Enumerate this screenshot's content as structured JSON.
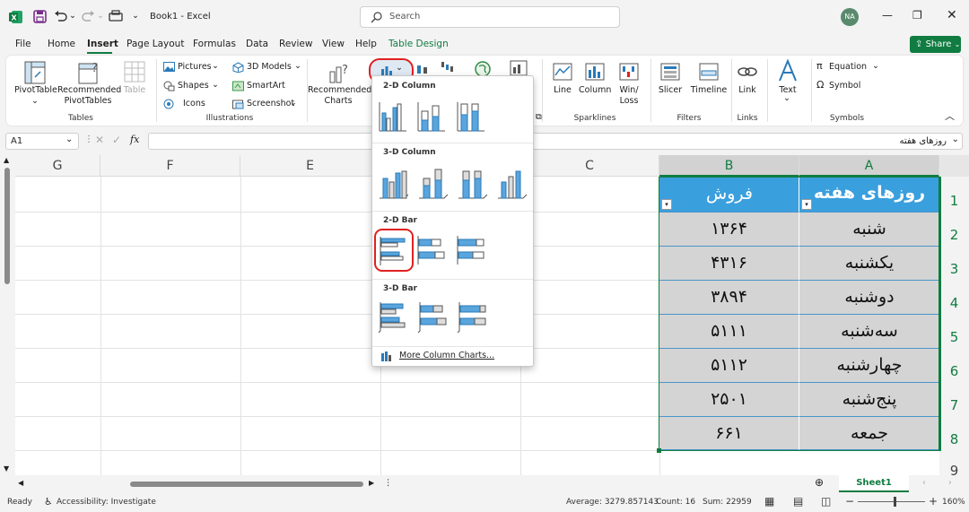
{
  "titlebar": {
    "title": "Book1 - Excel",
    "search_placeholder": "Search",
    "user_initials": "NA"
  },
  "tabs": [
    "File",
    "Home",
    "Insert",
    "Page Layout",
    "Formulas",
    "Data",
    "Review",
    "View",
    "Help",
    "Table Design"
  ],
  "share": "Share",
  "ribbon": {
    "pivottable": "PivotTable",
    "rec_pivot": "Recommended PivotTables",
    "table": "Table",
    "tables_group": "Tables",
    "pictures": "Pictures",
    "shapes": "Shapes",
    "icons": "Icons",
    "models": "3D Models",
    "smartart": "SmartArt",
    "screenshot": "Screenshot",
    "illustrations_group": "Illustrations",
    "rec_charts": "Recommended Charts",
    "line": "Line",
    "column": "Column",
    "winloss": "Win/ Loss",
    "sparklines_group": "Sparklines",
    "slicer": "Slicer",
    "timeline": "Timeline",
    "filters_group": "Filters",
    "link": "Link",
    "links_group": "Links",
    "text": "Text",
    "equation": "Equation",
    "symbol": "Symbol",
    "symbols_group": "Symbols"
  },
  "formula_bar": {
    "name_box": "A1",
    "content": "روزهای هفته",
    "fx": "fx"
  },
  "columns": [
    "G",
    "F",
    "E",
    "C",
    "B",
    "A"
  ],
  "rows": [
    "1",
    "2",
    "3",
    "4",
    "5",
    "6",
    "7",
    "8",
    "9"
  ],
  "table": {
    "header_a": "روزهای هفته",
    "header_b": "فروش",
    "days": [
      "شنبه",
      "یکشنبه",
      "دوشنبه",
      "سه‌شنبه",
      "چهارشنبه",
      "پنج‌شنبه",
      "جمعه"
    ],
    "sales": [
      "۱۳۶۴",
      "۴۳۱۶",
      "۳۸۹۴",
      "۵۱۱۱",
      "۵۱۱۲",
      "۲۵۰۱",
      "۶۶۱"
    ]
  },
  "dropdown": {
    "col2d": "2-D Column",
    "col3d": "3-D Column",
    "bar2d": "2-D Bar",
    "bar3d": "3-D Bar",
    "more": "More Column Charts..."
  },
  "sheet_tab": "Sheet1",
  "status": {
    "ready": "Ready",
    "accessibility": "Accessibility: Investigate",
    "average": "Average: 3279.857143",
    "count": "Count: 16",
    "sum": "Sum: 22959",
    "zoom": "160%"
  },
  "colors": {
    "excel_green": "#107c41",
    "table_header": "#3a9fdd",
    "cell_gray": "#d4d4d4",
    "highlight_red": "#e02020"
  }
}
